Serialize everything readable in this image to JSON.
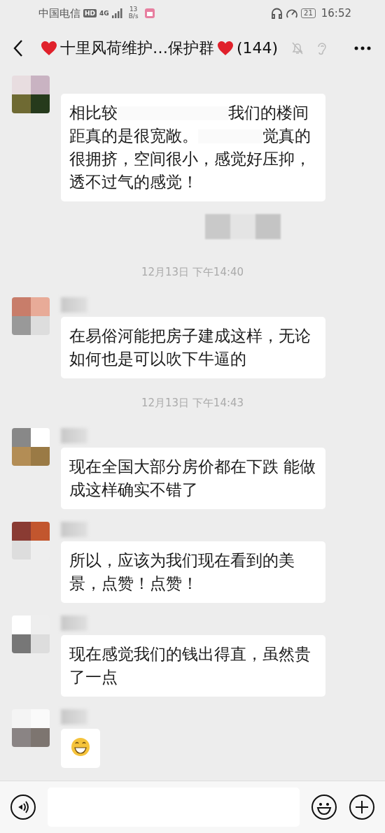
{
  "status_bar": {
    "carrier": "中国电信",
    "hd_badge": "HD",
    "network": "4G",
    "speed_value": "13",
    "speed_unit": "B/s",
    "battery": "21",
    "time": "16:52"
  },
  "title_bar": {
    "title": "十里风荷维护…保护群",
    "count": "(144)",
    "muted": true
  },
  "chat": [
    {
      "kind": "message",
      "name_blurred": false,
      "parts": [
        {
          "kind": "text",
          "text": "相比较"
        },
        {
          "kind": "blur"
        },
        {
          "kind": "text",
          "text": "我们的楼间距真的是很宽敞。"
        },
        {
          "kind": "blur"
        },
        {
          "kind": "text",
          "text": "觉真的很拥挤，空间很小，感觉好压抑，透不过气的感觉！"
        }
      ]
    },
    {
      "kind": "blurred"
    },
    {
      "kind": "time",
      "text": "12月13日 下午14:40"
    },
    {
      "kind": "message",
      "name_blurred": true,
      "parts": [
        {
          "kind": "text",
          "text": "在易俗河能把房子建成这样，无论如何也是可以吹下牛逼的"
        }
      ]
    },
    {
      "kind": "time",
      "text": "12月13日 下午14:43"
    },
    {
      "kind": "message",
      "name_blurred": true,
      "parts": [
        {
          "kind": "text",
          "text": "现在全国大部分房价都在下跌 能做成这样确实不错了"
        }
      ]
    },
    {
      "kind": "message",
      "name_blurred": true,
      "parts": [
        {
          "kind": "text",
          "text": "所以，应该为我们现在看到的美景，点赞！点赞！"
        }
      ]
    },
    {
      "kind": "message",
      "name_blurred": true,
      "parts": [
        {
          "kind": "text",
          "text": "现在感觉我们的钱出得直，虽然贵了一点"
        }
      ]
    },
    {
      "kind": "emoji",
      "name_blurred": true
    }
  ]
}
